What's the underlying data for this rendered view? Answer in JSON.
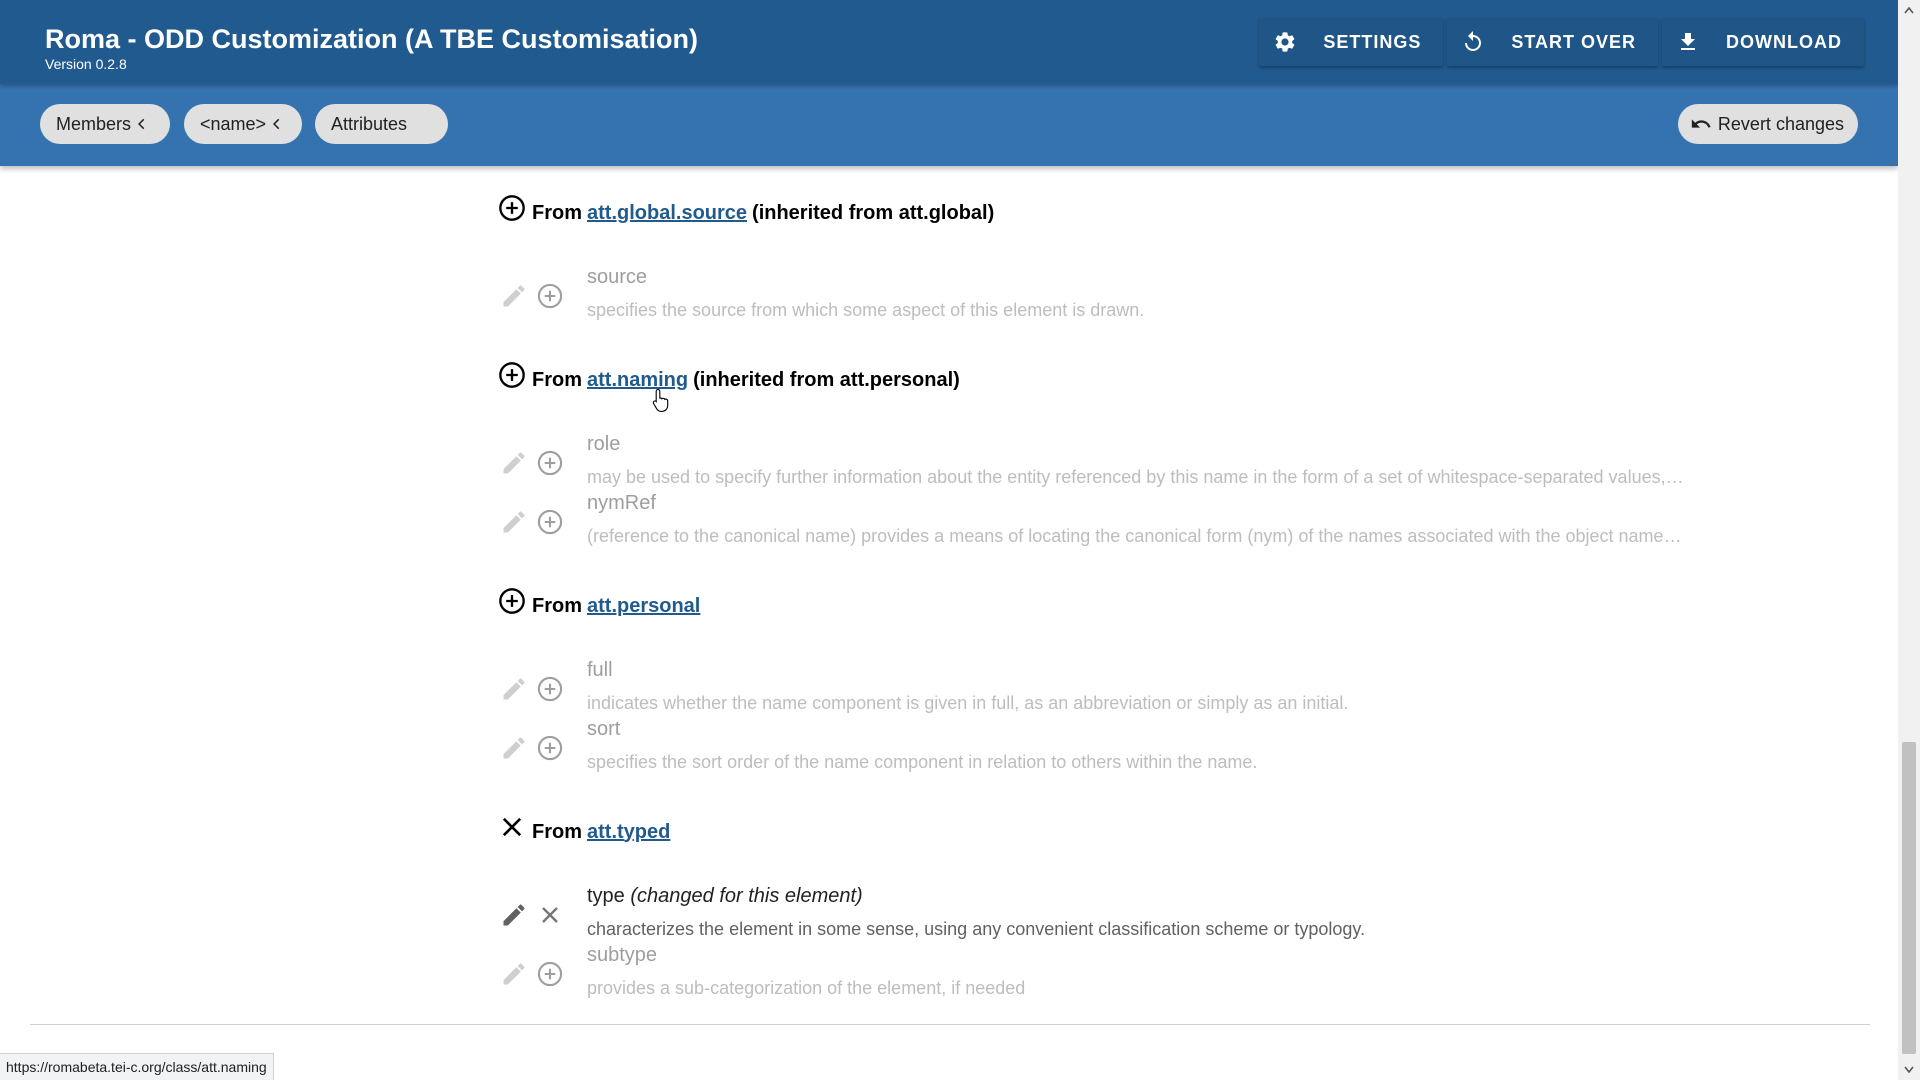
{
  "app": {
    "title": "Roma - ODD Customization (A TBE Customisation)",
    "version": "Version 0.2.8",
    "actions": {
      "settings": "SETTINGS",
      "start_over": "START OVER",
      "download": "DOWNLOAD"
    }
  },
  "toolbar": {
    "breadcrumbs": [
      "Members",
      "<name>",
      "Attributes"
    ],
    "revert": "Revert changes"
  },
  "groups": [
    {
      "prefix": "From",
      "link": "att.global.source",
      "suffix": "(inherited from att.global)",
      "state": "add",
      "attributes": [
        {
          "name": "source",
          "desc": "specifies the source from which some aspect of this element is drawn.",
          "note": ""
        }
      ]
    },
    {
      "prefix": "From",
      "link": "att.naming",
      "suffix": "(inherited from att.personal)",
      "state": "add",
      "attributes": [
        {
          "name": "role",
          "desc": "may be used to specify further information about the entity referenced by this name in the form of a set of whitespace-separated values,…",
          "note": ""
        },
        {
          "name": "nymRef",
          "desc": "(reference to the canonical name) provides a means of locating the canonical form (nym) of the names associated with the object name…",
          "note": ""
        }
      ]
    },
    {
      "prefix": "From",
      "link": "att.personal",
      "suffix": "",
      "state": "add",
      "attributes": [
        {
          "name": "full",
          "desc": "indicates whether the name component is given in full, as an abbreviation or simply as an initial.",
          "note": ""
        },
        {
          "name": "sort",
          "desc": "specifies the sort order of the name component in relation to others within the name.",
          "note": ""
        }
      ]
    },
    {
      "prefix": "From",
      "link": "att.typed",
      "suffix": "",
      "state": "remove",
      "attributes": [
        {
          "name": "type",
          "desc": "characterizes the element in some sense, using any convenient classification scheme or typology.",
          "note": "(changed for this element)"
        },
        {
          "name": "subtype",
          "desc": "provides a sub-categorization of the element, if needed",
          "note": ""
        }
      ]
    }
  ],
  "status_url": "https://romabeta.tei-c.org/class/att.naming",
  "colors": {
    "appbar": "#215a8e",
    "toolbar": "#3572b0",
    "link": "#215a8e",
    "chip": "#e0e0e0"
  }
}
